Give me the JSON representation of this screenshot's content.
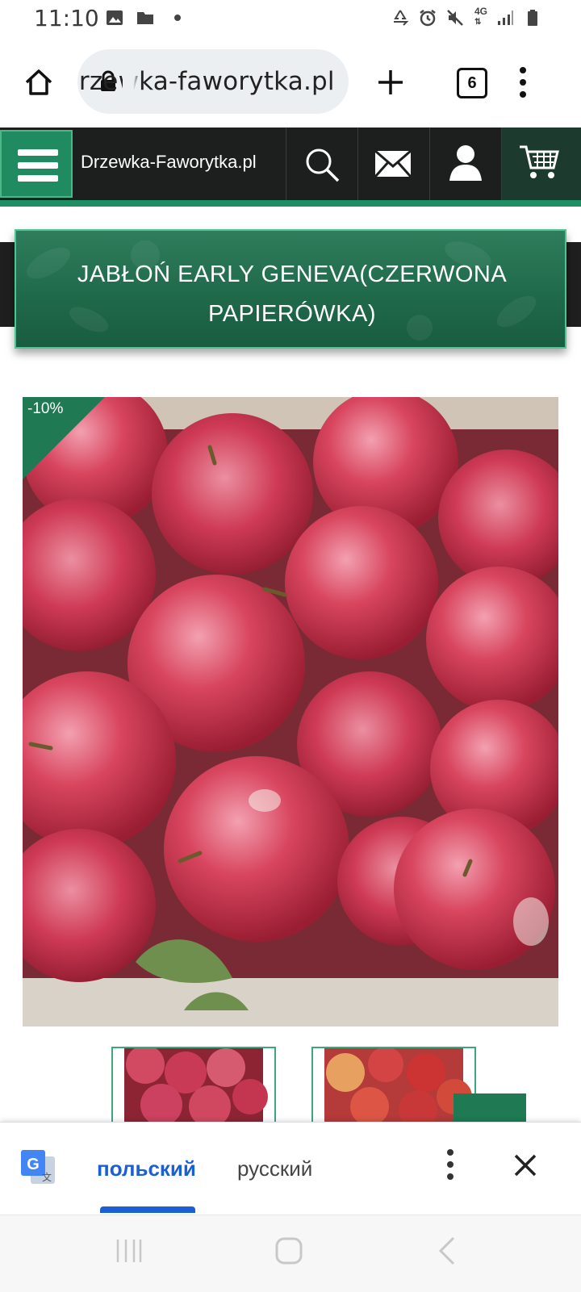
{
  "status_bar": {
    "time": "11:10",
    "left_icons": [
      "image-icon",
      "folder-icon",
      "dot-icon"
    ],
    "right_icons": [
      "recycle-icon",
      "alarm-icon",
      "mute-icon",
      "network-4g-icon",
      "signal-icon",
      "battery-icon"
    ],
    "network_label": "4G"
  },
  "browser": {
    "url": "drzewka-faworytka.pl",
    "tab_count": "6",
    "icons": [
      "home-icon",
      "lock-icon",
      "plus-icon",
      "tabs-icon",
      "more-icon"
    ]
  },
  "site_header": {
    "site_name": "Drzewka-Faworytka.pl",
    "icons": [
      "menu-icon",
      "search-icon",
      "mail-icon",
      "user-icon",
      "cart-icon"
    ],
    "accent_color": "#208a60"
  },
  "product": {
    "title": "JABŁOŃ EARLY GENEVA(CZERWONA PAPIERÓWKA)",
    "discount": "-10%"
  },
  "translate_bar": {
    "source_lang": "польский",
    "target_lang": "русский",
    "icons": [
      "google-translate-icon",
      "more-vert-icon",
      "close-icon"
    ],
    "accent_color": "#1a5fd6"
  },
  "nav_bar": {
    "icons": [
      "recents-icon",
      "home-nav-icon",
      "back-icon"
    ]
  }
}
